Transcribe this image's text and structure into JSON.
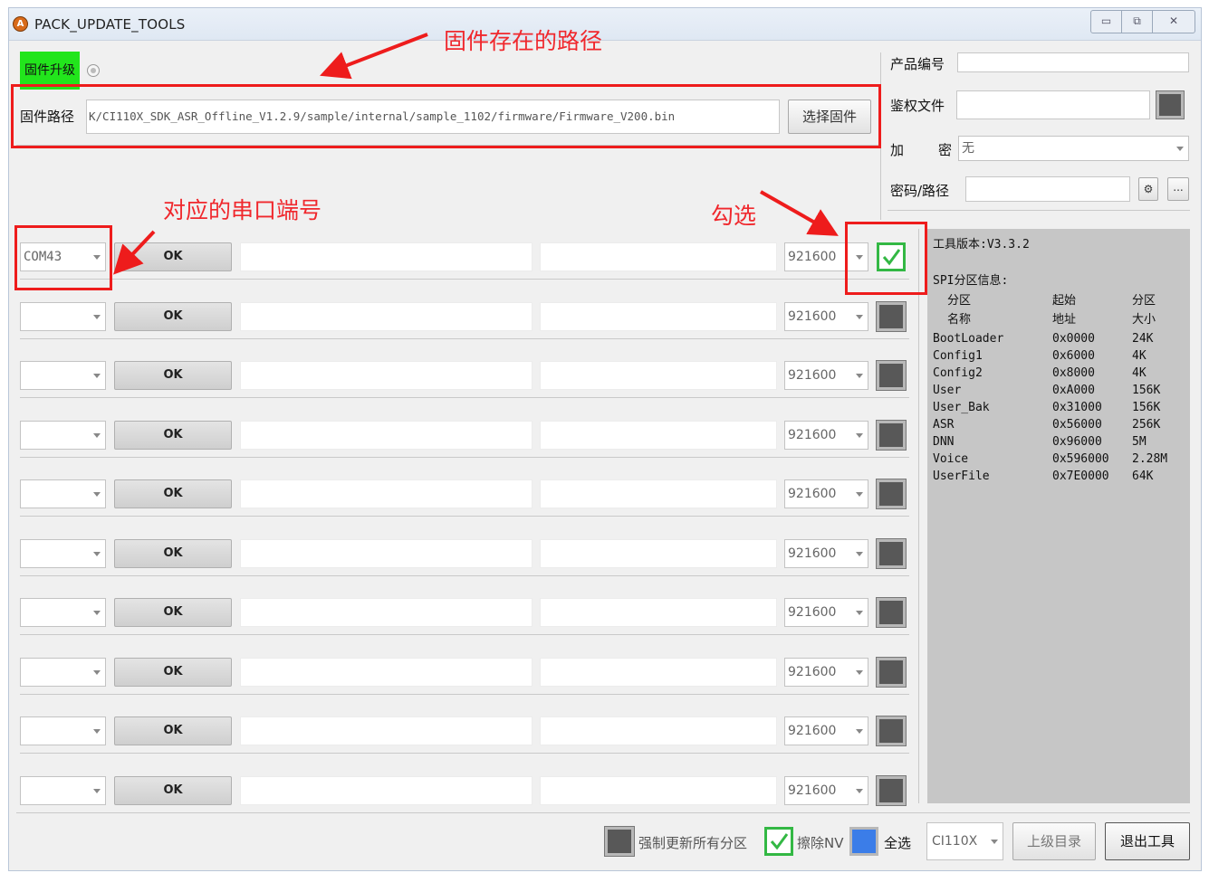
{
  "window": {
    "title": "PACK_UPDATE_TOOLS",
    "icon_text": "A",
    "controls": {
      "minimize": "▭",
      "restore": "⧉",
      "close": "✕"
    }
  },
  "upgrade": {
    "tab_label": "固件升级",
    "path_label": "固件路径",
    "path_value": "K/CI110X_SDK_ASR_Offline_V1.2.9/sample/internal/sample_1102/firmware/Firmware_V200.bin",
    "select_button": "选择固件"
  },
  "product": {
    "id_label": "产品编号",
    "id_value": "",
    "auth_label": "鉴权文件",
    "auth_value": "",
    "encrypt_label": "加",
    "encrypt_label2": "密",
    "encrypt_value": "无",
    "password_label": "密码/路径",
    "password_value": "",
    "dots_button": "..."
  },
  "rows": [
    {
      "port": "COM43",
      "ok": "OK",
      "baud": "921600",
      "checked": true
    },
    {
      "port": "",
      "ok": "OK",
      "baud": "921600",
      "checked": false
    },
    {
      "port": "",
      "ok": "OK",
      "baud": "921600",
      "checked": false
    },
    {
      "port": "",
      "ok": "OK",
      "baud": "921600",
      "checked": false
    },
    {
      "port": "",
      "ok": "OK",
      "baud": "921600",
      "checked": false
    },
    {
      "port": "",
      "ok": "OK",
      "baud": "921600",
      "checked": false
    },
    {
      "port": "",
      "ok": "OK",
      "baud": "921600",
      "checked": false
    },
    {
      "port": "",
      "ok": "OK",
      "baud": "921600",
      "checked": false
    },
    {
      "port": "",
      "ok": "OK",
      "baud": "921600",
      "checked": false
    },
    {
      "port": "",
      "ok": "OK",
      "baud": "921600",
      "checked": false
    }
  ],
  "info": {
    "tool_version": "工具版本:V3.3.2",
    "spi_title": "SPI分区信息:",
    "headers": [
      [
        "分区",
        "起始",
        "分区"
      ],
      [
        "名称",
        "地址",
        "大小"
      ]
    ],
    "partitions": [
      [
        "BootLoader",
        "0x0000",
        "24K"
      ],
      [
        "Config1",
        "0x6000",
        "4K"
      ],
      [
        "Config2",
        "0x8000",
        "4K"
      ],
      [
        "User",
        "0xA000",
        "156K"
      ],
      [
        "User_Bak",
        "0x31000",
        "156K"
      ],
      [
        "ASR",
        "0x56000",
        "256K"
      ],
      [
        "DNN",
        "0x96000",
        "5M"
      ],
      [
        "Voice",
        "0x596000",
        "2.28M"
      ],
      [
        "UserFile",
        "0x7E0000",
        "64K"
      ]
    ]
  },
  "footer": {
    "force_update_label": "强制更新所有分区",
    "force_update_checked": false,
    "erase_nv_label": "擦除NV",
    "erase_nv_checked": true,
    "select_all_label": "全选",
    "chip_value": "CI110X",
    "parent_dir_button": "上级目录",
    "exit_button": "退出工具"
  },
  "annotations": {
    "path_note": "固件存在的路径",
    "port_note": "对应的串口端号",
    "check_note": "勾选"
  },
  "colors": {
    "annotation_red": "#ee1c1c",
    "tab_highlight": "#22e51c",
    "check_green": "#33b844",
    "select_all_blue": "#3b7de8",
    "info_panel": "#c6c6c6"
  }
}
